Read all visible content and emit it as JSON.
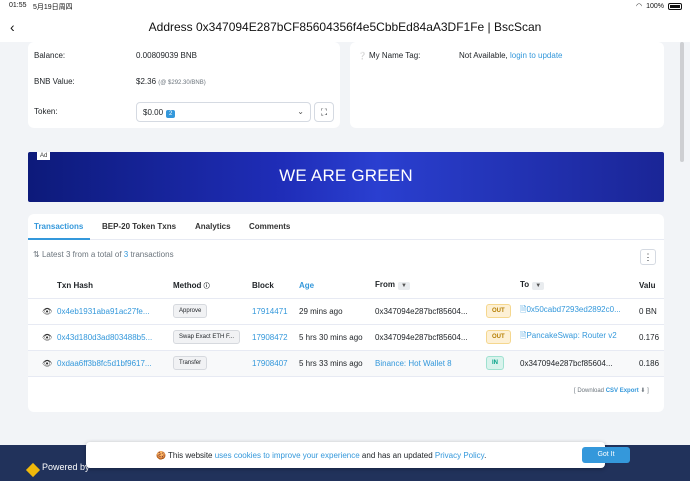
{
  "status": {
    "time": "01:55",
    "date": "5月19日周四",
    "battery": "100%"
  },
  "nav": {
    "title": "Address 0x347094E287bCF85604356f4e5CbbEd84aA3DF1Fe | BscScan"
  },
  "overview": {
    "balance_label": "Balance:",
    "balance_value": "0.00809039 BNB",
    "bnb_value_label": "BNB Value:",
    "bnb_value": "$2.36",
    "bnb_rate": "(@ $292.30/BNB)",
    "token_label": "Token:",
    "token_value": "$0.00",
    "token_count": "2"
  },
  "more_info": {
    "tag_label": "My Name Tag:",
    "tag_value": "Not Available,",
    "tag_link": "login to update"
  },
  "ad": {
    "label": "Ad",
    "text": "WE ARE GREEN"
  },
  "tabs": [
    "Transactions",
    "BEP-20 Token Txns",
    "Analytics",
    "Comments"
  ],
  "txn_info": {
    "prefix": "Latest 3 from a total of ",
    "count": "3",
    "suffix": " transactions"
  },
  "table": {
    "headers": {
      "hash": "Txn Hash",
      "method": "Method",
      "block": "Block",
      "age": "Age",
      "from": "From",
      "to": "To",
      "value": "Valu"
    },
    "rows": [
      {
        "hash": "0x4eb1931aba91ac27fe...",
        "method": "Approve",
        "block": "17914471",
        "age": "29 mins ago",
        "from": "0x347094e287bcf85604...",
        "dir": "OUT",
        "to": "0x50cabd7293ed2892c0...",
        "value": "0 BN"
      },
      {
        "hash": "0x43d180d3ad803488b5...",
        "method": "Swap Exact ETH F...",
        "block": "17908472",
        "age": "5 hrs 30 mins ago",
        "from": "0x347094e287bcf85604...",
        "dir": "OUT",
        "to": "PancakeSwap: Router v2",
        "value": "0.176"
      },
      {
        "hash": "0xdaa6ff3b8fc5d1bf9617...",
        "method": "Transfer",
        "block": "17908407",
        "age": "5 hrs 33 mins ago",
        "from": "Binance: Hot Wallet 8",
        "dir": "IN",
        "to": "0x347094e287bcf85604...",
        "value": "0.186"
      }
    ]
  },
  "download": {
    "prefix": "[ Download ",
    "link": "CSV Export",
    "suffix": " ]"
  },
  "footer": {
    "powered": "Powered by"
  },
  "cookie": {
    "t1": "This website ",
    "link1": "uses cookies to improve your experience",
    "t2": " and has an updated ",
    "link2": "Privacy Policy",
    "t3": ".",
    "button": "Got It"
  }
}
